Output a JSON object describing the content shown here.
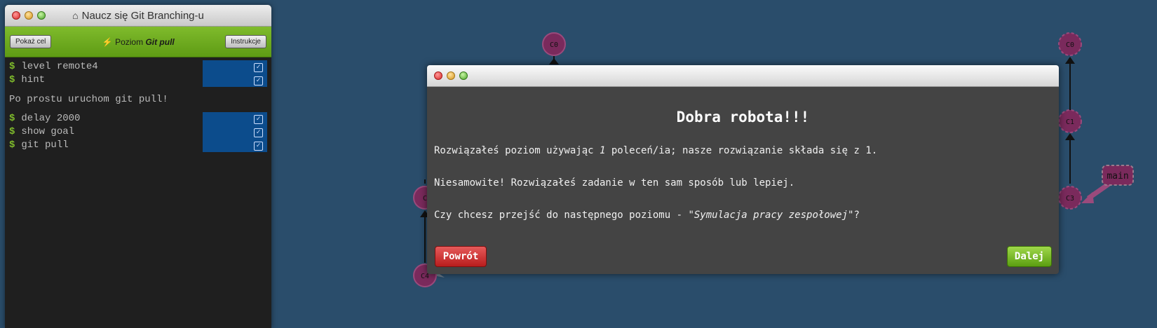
{
  "terminal": {
    "title": "Naucz się Git Branching-u",
    "home_icon": "home-icon",
    "show_goal_label": "Pokaż cel",
    "level_prefix": "Poziom",
    "level_name": "Git pull",
    "instructions_label": "Instrukcje",
    "commands_group1": [
      {
        "text": "level remote4"
      },
      {
        "text": "hint"
      }
    ],
    "hint_text": "Po prostu uruchom git pull!",
    "commands_group2": [
      {
        "text": "delay 2000"
      },
      {
        "text": "show goal"
      },
      {
        "text": "git pull"
      }
    ],
    "prompt_symbol": "$"
  },
  "graph": {
    "commits": [
      "C0",
      "C1",
      "C2",
      "C3",
      "C4"
    ],
    "branch_label": "main",
    "commit_color": "#7a2a5c"
  },
  "modal": {
    "title": "Dobra robota!!!",
    "line1_before": "Rozwiązałeś poziom używając ",
    "line1_count": "1",
    "line1_after": " poleceń/ia; nasze rozwiązanie składa się z 1.",
    "line2": "Niesamowite! Rozwiązałeś zadanie w ten sam sposób lub lepiej.",
    "line3_before": "Czy chcesz przejść do następnego poziomu - ",
    "line3_level": "\"Symulacja pracy zespołowej\"",
    "line3_after": "?",
    "back_label": "Powrót",
    "next_label": "Dalej"
  }
}
